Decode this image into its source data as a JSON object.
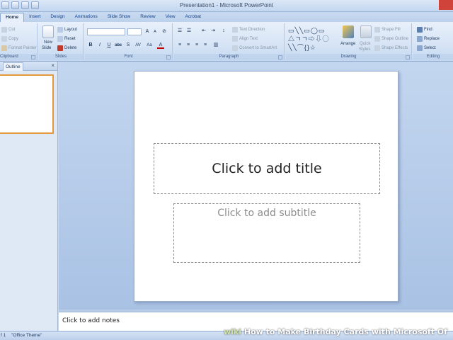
{
  "window": {
    "title": "Presentation1 - Microsoft PowerPoint"
  },
  "tabs": [
    "Home",
    "Insert",
    "Design",
    "Animations",
    "Slide Show",
    "Review",
    "View",
    "Acrobat"
  ],
  "ribbon": {
    "clipboard": {
      "label": "Clipboard",
      "cut": "Cut",
      "copy": "Copy",
      "format_painter": "Format Painter"
    },
    "slides": {
      "label": "Slides",
      "new_slide": "New",
      "new_slide2": "Slide",
      "layout": "Layout",
      "reset": "Reset",
      "delete": "Delete"
    },
    "font": {
      "label": "Font",
      "bold": "B",
      "italic": "I",
      "underline": "U",
      "strike": "abc",
      "shadow": "S",
      "spacing": "AV",
      "case": "Aa",
      "color": "A",
      "grow": "A",
      "shrink": "A"
    },
    "paragraph": {
      "label": "Paragraph",
      "text_direction": "Text Direction",
      "align_text": "Align Text",
      "convert_smartart": "Convert to SmartArt"
    },
    "drawing": {
      "label": "Drawing",
      "arrange": "Arrange",
      "quick_styles": "Quick",
      "quick_styles2": "Styles",
      "shape_fill": "Shape Fill",
      "shape_outline": "Shape Outline",
      "shape_effects": "Shape Effects"
    },
    "editing": {
      "label": "Editing",
      "find": "Find",
      "replace": "Replace",
      "select": "Select"
    }
  },
  "left_panel": {
    "tab": "Outline",
    "close": "×"
  },
  "slide": {
    "title_placeholder": "Click to add title",
    "subtitle_placeholder": "Click to add subtitle"
  },
  "notes": {
    "placeholder": "Click to add notes"
  },
  "status": {
    "slide": "f 1",
    "theme": "\"Office Theme\""
  },
  "watermark": {
    "prefix": "wiki",
    "text": "How to Make Birthday Cards with Microsoft Of"
  },
  "colors": {
    "accent": "#e49a3c",
    "ribbon": "#d6e4f5",
    "close": "#d0433a"
  }
}
